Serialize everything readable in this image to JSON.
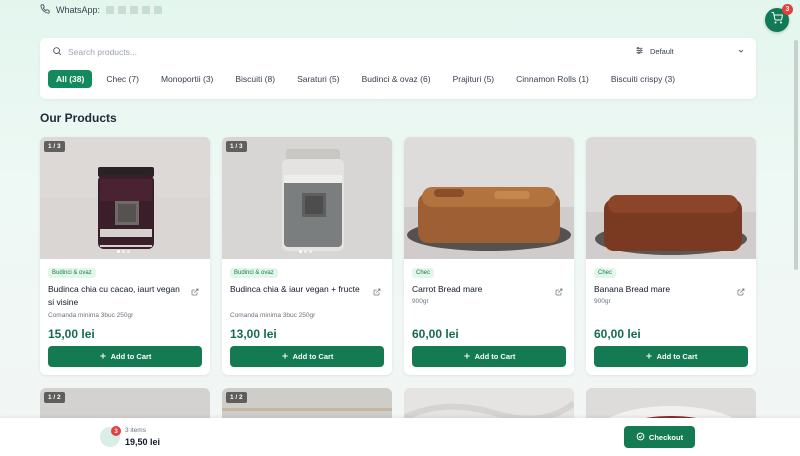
{
  "header": {
    "whatsapp_label": "WhatsApp:",
    "cart_count": "3"
  },
  "search": {
    "placeholder": "Search products...",
    "sort_value": "Default"
  },
  "categories": [
    {
      "label": "All (38)",
      "active": true
    },
    {
      "label": "Chec (7)"
    },
    {
      "label": "Monoportii (3)"
    },
    {
      "label": "Biscuiti (8)"
    },
    {
      "label": "Saraturi (5)"
    },
    {
      "label": "Budinci & ovaz (6)"
    },
    {
      "label": "Prajituri (5)"
    },
    {
      "label": "Cinnamon Rolls (1)"
    },
    {
      "label": "Biscuiti crispy (3)"
    }
  ],
  "section_title": "Our Products",
  "products": [
    {
      "counter": "1 / 3",
      "tag": "Budinci & ovaz",
      "name": "Budinca chia cu cacao, iaurt vegan si visine",
      "note": "Comanda minima 3buc 250gr",
      "price": "15,00 lei",
      "button": "Add to Cart"
    },
    {
      "counter": "1 / 3",
      "tag": "Budinci & ovaz",
      "name": "Budinca chia & iaur vegan + fructe",
      "note": "Comanda minima 3buc 250gr",
      "price": "13,00 lei",
      "button": "Add to Cart"
    },
    {
      "counter": "",
      "tag": "Chec",
      "name": "Carrot Bread mare",
      "note": "900gr",
      "price": "60,00 lei",
      "button": "Add to Cart"
    },
    {
      "counter": "",
      "tag": "Chec",
      "name": "Banana Bread mare",
      "note": "900gr",
      "price": "60,00 lei",
      "button": "Add to Cart"
    }
  ],
  "row2_counters": [
    "1 / 2",
    "1 / 2"
  ],
  "bottom_bar": {
    "items": "3 items",
    "total": "19,50 lei",
    "badge": "3",
    "checkout": "Checkout"
  },
  "colors": {
    "primary": "#147a52",
    "badge": "#e53e3e"
  }
}
